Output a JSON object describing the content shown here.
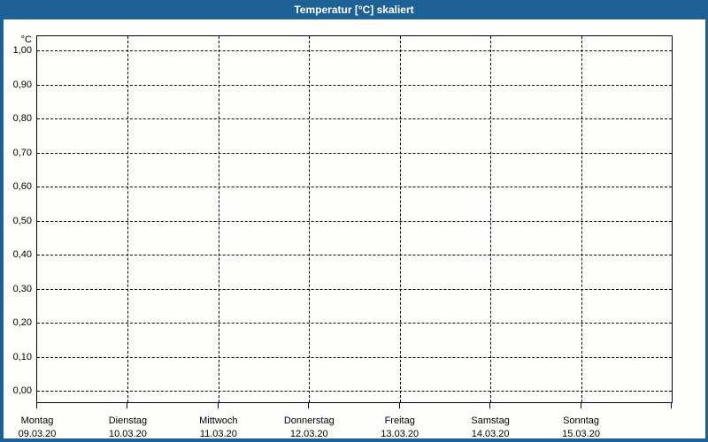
{
  "window": {
    "title": "Temperatur [°C] skaliert"
  },
  "colors": {
    "title_bar": "#1e6195",
    "title_text": "#ffffff",
    "window_frame": "#1e6195",
    "background": "#fdfefb",
    "plot_border": "#000000",
    "gridline": "#000000",
    "label_text": "#000000"
  },
  "chart_data": {
    "type": "line",
    "title": "Temperatur [°C] skaliert",
    "xlabel": "",
    "ylabel": "°C",
    "ylim": [
      0.0,
      1.0
    ],
    "y_tick_step": 0.1,
    "y_tick_labels": [
      "1,00",
      "0,90",
      "0,80",
      "0,70",
      "0,60",
      "0,50",
      "0,40",
      "0,30",
      "0,20",
      "0,10",
      "0,00"
    ],
    "x_axis": {
      "days": [
        {
          "name": "Montag",
          "date": "09.03.20"
        },
        {
          "name": "Dienstag",
          "date": "10.03.20"
        },
        {
          "name": "Mittwoch",
          "date": "11.03.20"
        },
        {
          "name": "Donnerstag",
          "date": "12.03.20"
        },
        {
          "name": "Freitag",
          "date": "13.03.20"
        },
        {
          "name": "Samstag",
          "date": "14.03.20"
        },
        {
          "name": "Sonntag",
          "date": "15.03.20"
        }
      ]
    },
    "series": [],
    "grid": {
      "style": "dashed",
      "horizontal": true,
      "vertical": true
    },
    "legend": "none"
  }
}
